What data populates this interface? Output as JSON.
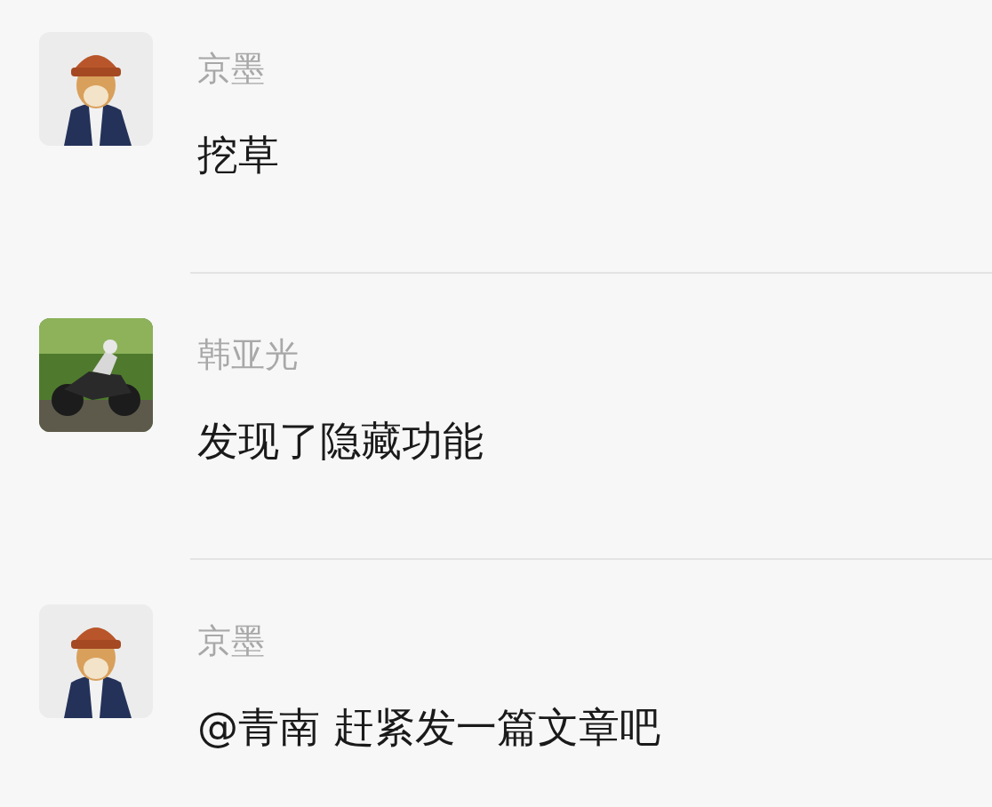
{
  "messages": [
    {
      "author": "京墨",
      "text": "挖草"
    },
    {
      "author": "韩亚光",
      "text": "发现了隐藏功能"
    },
    {
      "author": "京墨",
      "text": "@青南 赶紧发一篇文章吧"
    }
  ]
}
